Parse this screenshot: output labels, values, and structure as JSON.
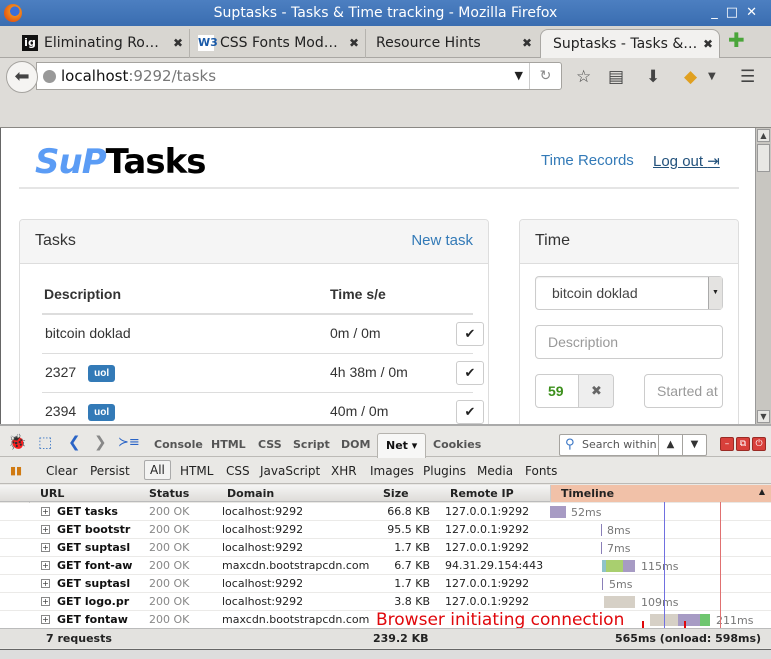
{
  "window": {
    "title": "Suptasks - Tasks & Time tracking - Mozilla Firefox",
    "controls": [
      "_",
      "□",
      "✕"
    ]
  },
  "tabs": [
    {
      "label": "Eliminating Ro…",
      "favicon": "ig"
    },
    {
      "label": "CSS Fonts Mod…",
      "favicon": "W3"
    },
    {
      "label": "Resource Hints",
      "favicon": ""
    },
    {
      "label": "Suptasks - Tasks &…",
      "favicon": "",
      "active": true
    }
  ],
  "navbar": {
    "url_host": "localhost",
    "url_rest": ":9292/tasks"
  },
  "page": {
    "logo_a": "SuP",
    "logo_b": "Tasks",
    "nav": {
      "time_records": "Time Records",
      "logout": "Log out"
    },
    "tasks_panel": {
      "title": "Tasks",
      "new_task": "New task",
      "columns": [
        "Description",
        "Time s/e"
      ],
      "rows": [
        {
          "description": "bitcoin doklad",
          "badge": "",
          "time": "0m / 0m"
        },
        {
          "description": "2327",
          "badge": "uol",
          "time": "4h 38m / 0m"
        },
        {
          "description": "2394",
          "badge": "uol",
          "time": "40m / 0m"
        }
      ]
    },
    "time_panel": {
      "title": "Time",
      "selected_task": "bitcoin doklad",
      "description_placeholder": "Description",
      "timer_value": "59",
      "started_placeholder": "Started at"
    }
  },
  "devtools": {
    "panels": [
      "Console",
      "HTML",
      "CSS",
      "Script",
      "DOM",
      "Net ▾",
      "Cookies"
    ],
    "active_panel": "Net",
    "search_placeholder": "Search within Net",
    "actions": {
      "clear": "Clear",
      "persist": "Persist"
    },
    "filters": [
      "All",
      "HTML",
      "CSS",
      "JavaScript",
      "XHR",
      "Images",
      "Plugins",
      "Media",
      "Fonts"
    ],
    "columns": {
      "url": "URL",
      "status": "Status",
      "domain": "Domain",
      "size": "Size",
      "remote_ip": "Remote IP",
      "timeline": "Timeline"
    },
    "requests": [
      {
        "url": "GET tasks",
        "status": "200 OK",
        "domain": "localhost:9292",
        "size": "66.8 KB",
        "ip": "127.0.0.1:9292",
        "time": "52ms"
      },
      {
        "url": "GET bootstr",
        "status": "200 OK",
        "domain": "localhost:9292",
        "size": "95.5 KB",
        "ip": "127.0.0.1:9292",
        "time": "8ms"
      },
      {
        "url": "GET suptasl",
        "status": "200 OK",
        "domain": "localhost:9292",
        "size": "1.7 KB",
        "ip": "127.0.0.1:9292",
        "time": "7ms"
      },
      {
        "url": "GET font-aw",
        "status": "200 OK",
        "domain": "maxcdn.bootstrapcdn.com",
        "size": "6.7 KB",
        "ip": "94.31.29.154:443",
        "time": "115ms"
      },
      {
        "url": "GET suptasl",
        "status": "200 OK",
        "domain": "localhost:9292",
        "size": "1.7 KB",
        "ip": "127.0.0.1:9292",
        "time": "5ms"
      },
      {
        "url": "GET logo.pr",
        "status": "200 OK",
        "domain": "localhost:9292",
        "size": "3.8 KB",
        "ip": "127.0.0.1:9292",
        "time": "109ms"
      },
      {
        "url": "GET fontaw",
        "status": "200 OK",
        "domain": "maxcdn.bootstrapcdn.com",
        "size": "",
        "ip": "",
        "time": "211ms"
      }
    ],
    "summary": {
      "count": "7 requests",
      "total_size": "239.2 KB",
      "total_time": "565ms (onload: 598ms)"
    },
    "annotation": "Browser initiating connection"
  }
}
